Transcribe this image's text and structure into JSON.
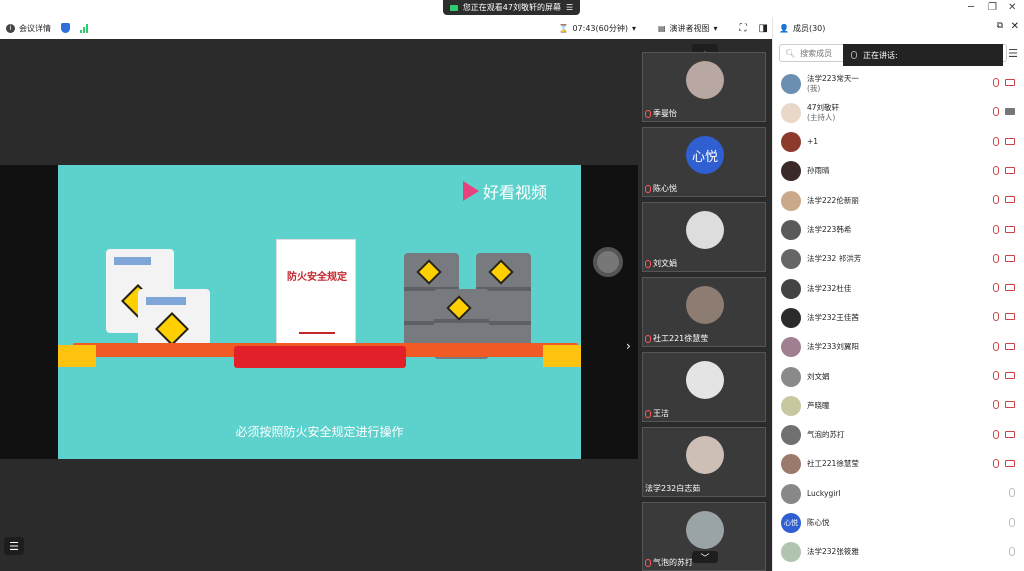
{
  "titlebar": {
    "viewing_text": "您正在观看47刘敬轩的屏幕",
    "menu_icon": "hamburger-icon",
    "minimize_icon": "minimize-icon",
    "restore_icon": "restore-icon",
    "close_icon": "close-icon"
  },
  "toolbar": {
    "meeting_info_label": "会议详情",
    "timer": "07:43(60分钟)",
    "view_mode_label": "演讲者视图",
    "signal_color": "#2ecc71",
    "shield_color": "#2f6fdc"
  },
  "slide": {
    "brand": "好看视频",
    "doc_title": "防火安全规定",
    "subtitle": "必须按照防火安全规定进行操作",
    "bg_color": "#5dd2cd"
  },
  "gallery": {
    "tiles": [
      {
        "name": "季曼怡",
        "avatar": "photo"
      },
      {
        "name": "陈心悦",
        "avatar": "text",
        "avatar_text": "心悦"
      },
      {
        "name": "刘文娟",
        "avatar": "photo"
      },
      {
        "name": "社工221徐慧莹",
        "avatar": "photo"
      },
      {
        "name": "王洁",
        "avatar": "photo"
      },
      {
        "name": "法学232白志茹",
        "avatar": "photo"
      },
      {
        "name": "气泡的苏打",
        "avatar": "photo"
      }
    ]
  },
  "members": {
    "title": "成员(30)",
    "search_placeholder": "搜索成员",
    "speaking_label": "正在讲话:",
    "list": [
      {
        "name": "法学223常天一",
        "sub": "(我)",
        "mic": "muted",
        "cam": "off"
      },
      {
        "name": "47刘敬轩",
        "sub": "(主持人)",
        "mic": "muted",
        "cam": "screen"
      },
      {
        "name": "+1",
        "sub": "",
        "mic": "muted",
        "cam": "off"
      },
      {
        "name": "孙雨晴",
        "sub": "",
        "mic": "muted",
        "cam": "off"
      },
      {
        "name": "法学222伦新丽",
        "sub": "",
        "mic": "muted",
        "cam": "off"
      },
      {
        "name": "法学223韩希",
        "sub": "",
        "mic": "muted",
        "cam": "off"
      },
      {
        "name": "法学232 祁洪芳",
        "sub": "",
        "mic": "muted",
        "cam": "off"
      },
      {
        "name": "法学232杜佳",
        "sub": "",
        "mic": "muted",
        "cam": "off"
      },
      {
        "name": "法学232王佳茜",
        "sub": "",
        "mic": "muted",
        "cam": "off"
      },
      {
        "name": "法学233刘翼阳",
        "sub": "",
        "mic": "muted",
        "cam": "off"
      },
      {
        "name": "刘文娟",
        "sub": "",
        "mic": "muted",
        "cam": "off"
      },
      {
        "name": "芦晓瞳",
        "sub": "",
        "mic": "muted",
        "cam": "off"
      },
      {
        "name": "气泡的苏打",
        "sub": "",
        "mic": "muted",
        "cam": "off"
      },
      {
        "name": "社工221徐慧莹",
        "sub": "",
        "mic": "muted",
        "cam": "off"
      },
      {
        "name": "Luckygirl",
        "sub": "",
        "mic": "gray",
        "cam": "none"
      },
      {
        "name": "陈心悦",
        "sub": "",
        "mic": "gray",
        "cam": "none",
        "avatar_text": "心悦"
      },
      {
        "name": "法学232张筱雅",
        "sub": "",
        "mic": "gray",
        "cam": "none"
      }
    ]
  }
}
